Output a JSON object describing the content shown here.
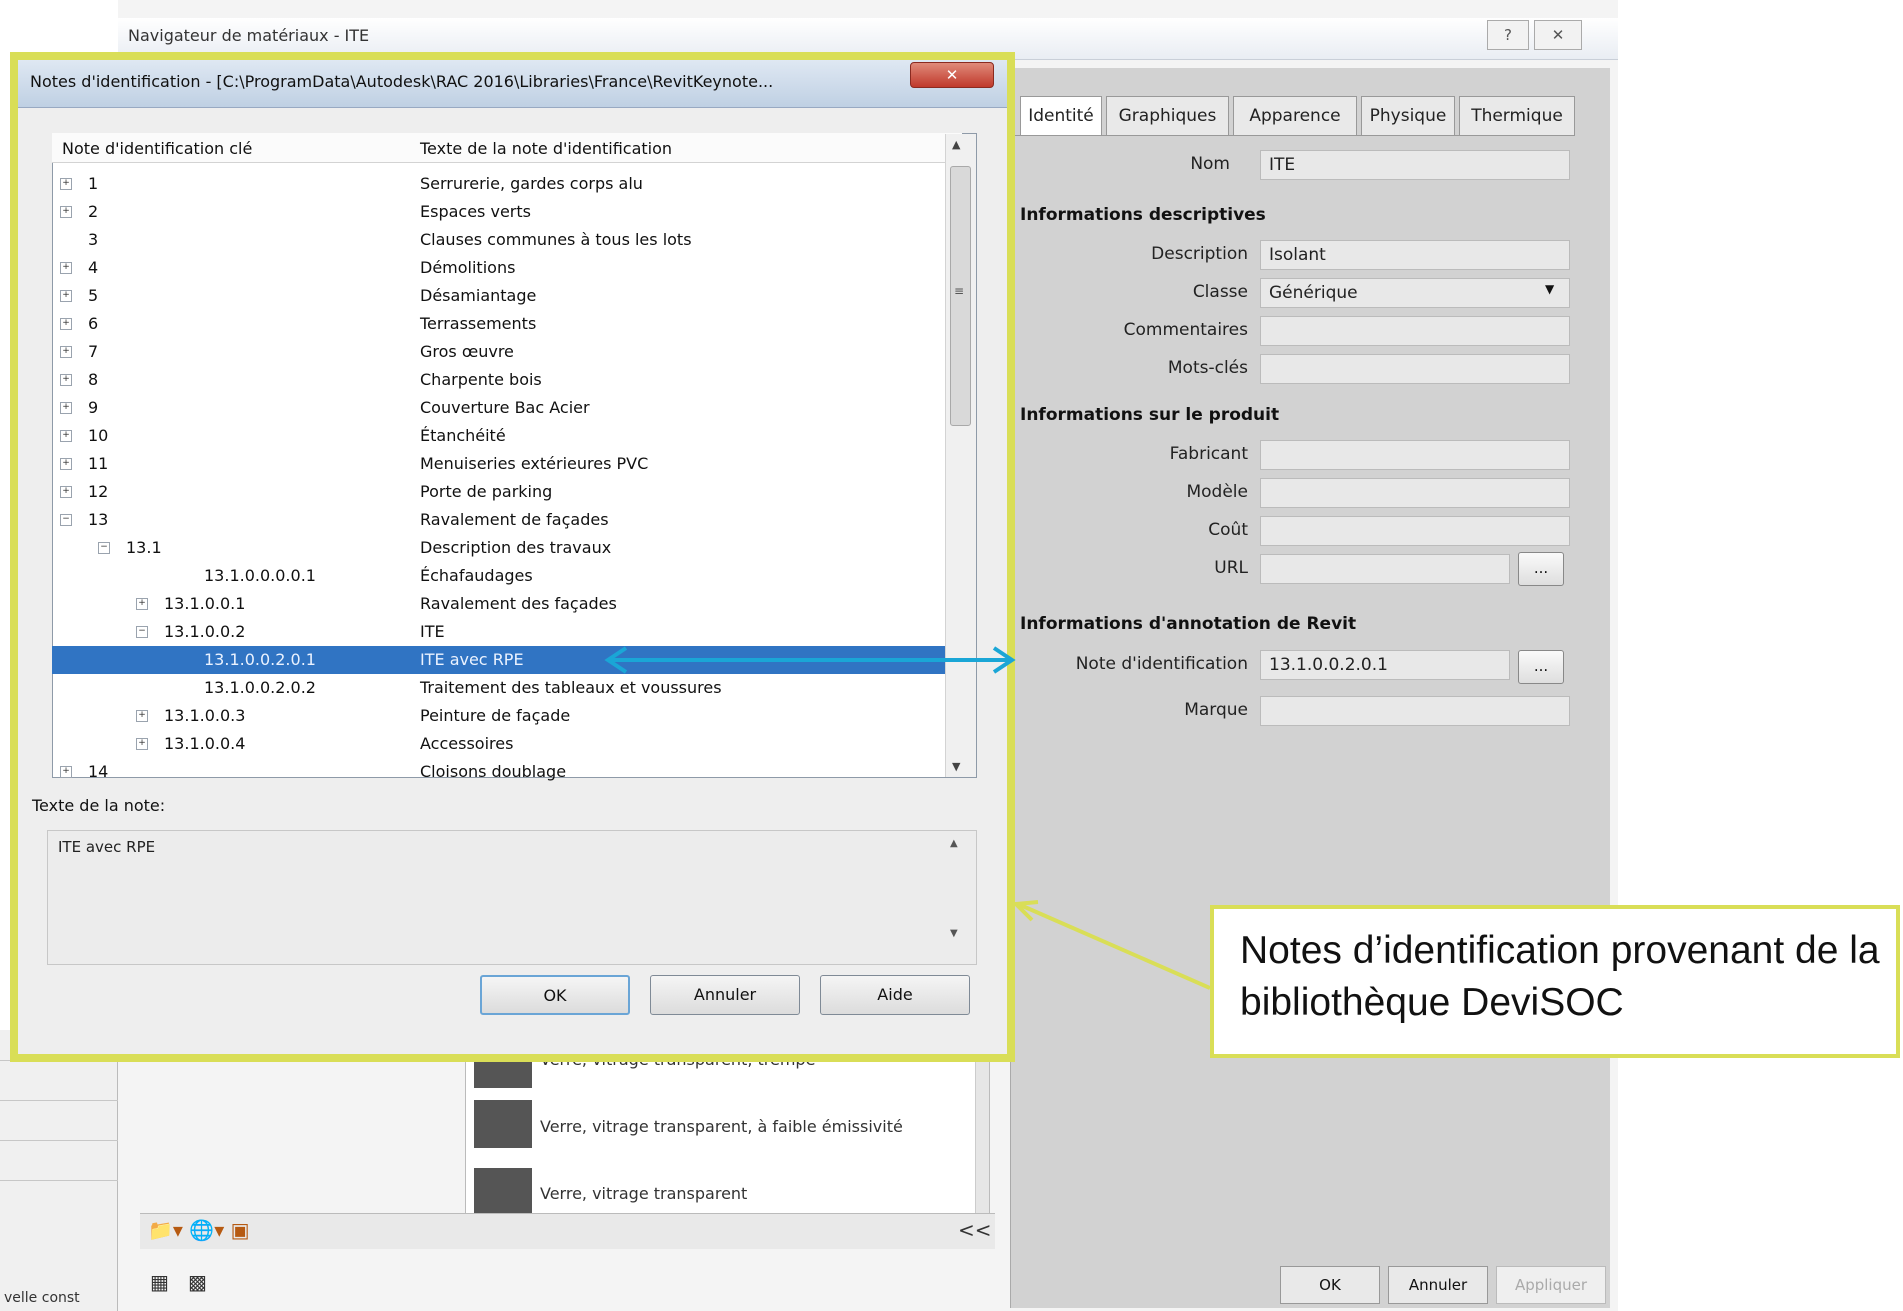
{
  "background_window": {
    "title": "Navigateur de matériaux - ITE",
    "help_label": "?",
    "close_label": "✕",
    "tabs": [
      "Identité",
      "Graphiques",
      "Apparence",
      "Physique",
      "Thermique"
    ],
    "name_label": "Nom",
    "name_value": "ITE",
    "sections": {
      "descriptive": "Informations descriptives",
      "product": "Informations sur le produit",
      "annotation": "Informations d'annotation de Revit"
    },
    "fields": {
      "description_label": "Description",
      "description_value": "Isolant",
      "class_label": "Classe",
      "class_value": "Générique",
      "comments_label": "Commentaires",
      "comments_value": "",
      "keywords_label": "Mots-clés",
      "keywords_value": "",
      "manufacturer_label": "Fabricant",
      "manufacturer_value": "",
      "model_label": "Modèle",
      "model_value": "",
      "cost_label": "Coût",
      "cost_value": "",
      "url_label": "URL",
      "url_value": "",
      "keynote_label": "Note d'identification",
      "keynote_value": "13.1.0.0.2.0.1",
      "mark_label": "Marque",
      "mark_value": ""
    },
    "browse_label": "...",
    "bottom_buttons": {
      "ok": "OK",
      "cancel": "Annuler",
      "apply": "Appliquer"
    },
    "materials": [
      "Verre, vitrage transparent, trempé",
      "Verre, vitrage transparent, à faible émissivité",
      "Verre, vitrage transparent"
    ],
    "collapse_label": "<<",
    "left_partial_text": "velle const"
  },
  "dialog": {
    "title": "Notes d'identification - [C:\\ProgramData\\Autodesk\\RAC 2016\\Libraries\\France\\RevitKeynote...",
    "close_label": "✕",
    "col_key": "Note d'identification clé",
    "col_text": "Texte de la note d'identification",
    "rows": [
      {
        "key": "1",
        "text": "Serrurerie, gardes corps alu"
      },
      {
        "key": "2",
        "text": "Espaces verts"
      },
      {
        "key": "3",
        "text": "Clauses communes à tous les lots"
      },
      {
        "key": "4",
        "text": "Démolitions"
      },
      {
        "key": "5",
        "text": "Désamiantage"
      },
      {
        "key": "6",
        "text": "Terrassements"
      },
      {
        "key": "7",
        "text": "Gros œuvre"
      },
      {
        "key": "8",
        "text": "Charpente bois"
      },
      {
        "key": "9",
        "text": "Couverture Bac Acier"
      },
      {
        "key": "10",
        "text": "Étanchéité"
      },
      {
        "key": "11",
        "text": "Menuiseries extérieures PVC"
      },
      {
        "key": "12",
        "text": "Porte de parking"
      },
      {
        "key": "13",
        "text": "Ravalement de façades"
      },
      {
        "key": "13.1",
        "text": "Description des travaux"
      },
      {
        "key": "13.1.0.0.0.0.1",
        "text": "Échafaudages"
      },
      {
        "key": "13.1.0.0.1",
        "text": "Ravalement des façades"
      },
      {
        "key": "13.1.0.0.2",
        "text": "ITE"
      },
      {
        "key": "13.1.0.0.2.0.1",
        "text": "ITE avec RPE"
      },
      {
        "key": "13.1.0.0.2.0.2",
        "text": "Traitement des tableaux et voussures"
      },
      {
        "key": "13.1.0.0.3",
        "text": "Peinture de façade"
      },
      {
        "key": "13.1.0.0.4",
        "text": "Accessoires"
      },
      {
        "key": "14",
        "text": "Cloisons doublage"
      }
    ],
    "note_label": "Texte de la note:",
    "note_text": "ITE avec RPE",
    "buttons": {
      "ok": "OK",
      "cancel": "Annuler",
      "help": "Aide"
    }
  },
  "callout": {
    "text": "Notes d’identification provenant de la bibliothèque DeviSOC"
  },
  "colors": {
    "highlight_border": "#d9de57",
    "selection": "#3074c3",
    "arrow": "#1aa6d6"
  }
}
